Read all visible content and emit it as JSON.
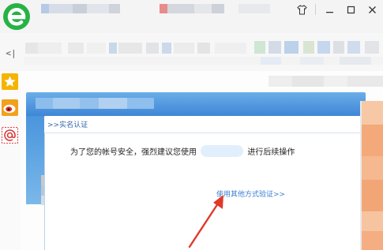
{
  "window": {
    "controls": [
      {
        "name": "shirt-skin-icon",
        "glyph": "⌂"
      },
      {
        "name": "minimize-icon",
        "glyph": "—"
      },
      {
        "name": "maximize-icon",
        "glyph": "☐"
      },
      {
        "name": "close-icon",
        "glyph": "✕"
      }
    ]
  },
  "sidebar": {
    "collapse_glyph": "<|",
    "items": [
      {
        "name": "favorites-star-icon",
        "color": "#f5b400"
      },
      {
        "name": "weibo-icon",
        "color": "#e0322c"
      },
      {
        "name": "email-at-icon",
        "color": "#d93a3a"
      }
    ]
  },
  "dialog": {
    "breadcrumb": ">>实名认证",
    "message_before": "为了您的帐号安全，强烈建议您使用",
    "message_after": "进行后续操作",
    "alt_link": "使用其他方式验证>>"
  },
  "colors": {
    "brand_green": "#27b244",
    "dialog_blue": "#3f86d6",
    "link_blue": "#3b7fd1",
    "arrow_red": "#e0392b",
    "right_orange": "#f3a97a"
  }
}
